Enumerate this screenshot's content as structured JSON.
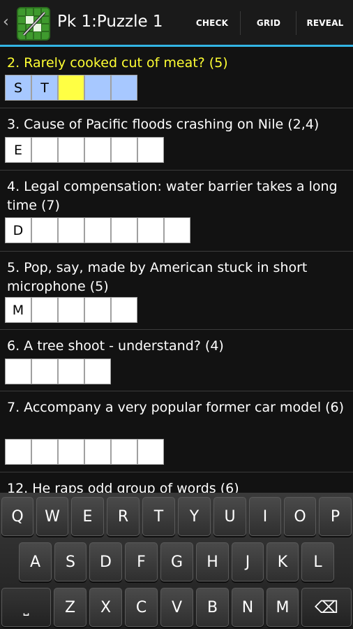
{
  "header": {
    "back_glyph": "‹",
    "title": "Pk 1:Puzzle 1",
    "actions": [
      "CHECK",
      "GRID",
      "REVEAL"
    ]
  },
  "clues": [
    {
      "text": "2. Rarely cooked cut of meat? (5)",
      "active": true,
      "cells": [
        "S",
        "T",
        "",
        "",
        ""
      ]
    },
    {
      "text": "3. Cause of Pacific floods crashing on Nile (2,4)",
      "active": false,
      "cells": [
        "E",
        "",
        "",
        "",
        "",
        ""
      ]
    },
    {
      "text": "4. Legal compensation: water barrier takes a long time (7)",
      "active": false,
      "cells": [
        "D",
        "",
        "",
        "",
        "",
        "",
        ""
      ]
    },
    {
      "text": "5. Pop, say, made by American stuck in short microphone (5)",
      "active": false,
      "cells": [
        "M",
        "",
        "",
        "",
        ""
      ]
    },
    {
      "text": "6. A tree shoot - understand? (4)",
      "active": false,
      "cells": [
        "",
        "",
        "",
        ""
      ]
    },
    {
      "text": "7. Accompany a very popular former car model (6)",
      "active": false,
      "cells": [
        "",
        "",
        "",
        "",
        "",
        ""
      ]
    },
    {
      "text": "12. He raps odd group of words (6)",
      "active": false,
      "cells": []
    }
  ],
  "keyboard": {
    "row1": [
      "Q",
      "W",
      "E",
      "R",
      "T",
      "Y",
      "U",
      "I",
      "O",
      "P"
    ],
    "row2": [
      "A",
      "S",
      "D",
      "F",
      "G",
      "H",
      "J",
      "K",
      "L"
    ],
    "row3": [
      "Z",
      "X",
      "C",
      "V",
      "B",
      "N",
      "M"
    ],
    "space_glyph": "⎵",
    "delete_glyph": "⌫"
  },
  "colors": {
    "accent": "#33b5e5",
    "active_clue": "#ffff33",
    "word_highlight": "#a7c8ff",
    "current_cell": "#ffff44"
  }
}
